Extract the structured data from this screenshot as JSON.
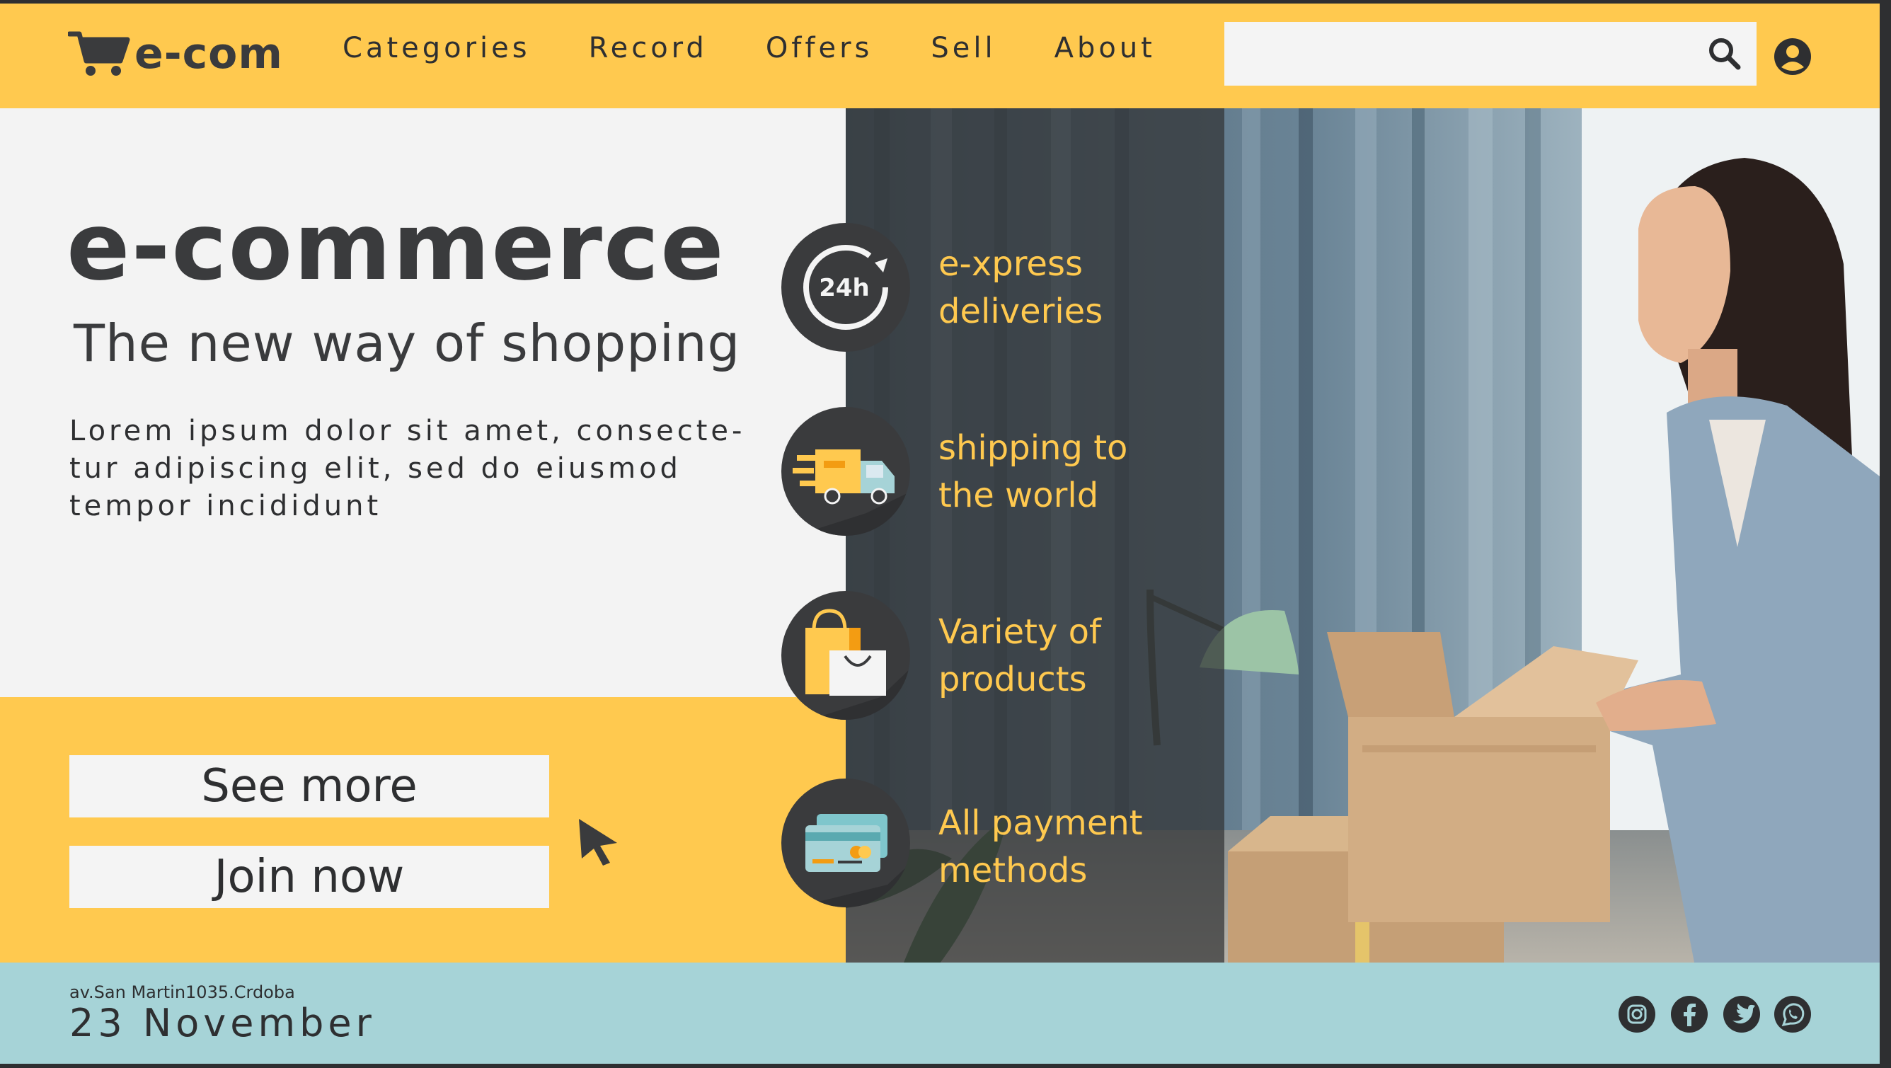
{
  "brand": {
    "name": "e-com",
    "icon": "shopping-cart-icon"
  },
  "nav": {
    "items": [
      {
        "label": "Categories"
      },
      {
        "label": "Record"
      },
      {
        "label": "Offers"
      },
      {
        "label": "Sell"
      },
      {
        "label": "About"
      }
    ]
  },
  "search": {
    "value": "",
    "placeholder": "",
    "icon": "search-icon"
  },
  "account": {
    "icon": "user-account-icon"
  },
  "hero": {
    "title": "e-commerce",
    "subtitle": "The new way of shopping",
    "body_lines": [
      "Lorem ipsum dolor sit amet, consecte-",
      "tur adipiscing elit, sed do eiusmod",
      "tempor incididunt"
    ]
  },
  "buttons": {
    "see_more": "See more",
    "join_now": "Join now"
  },
  "features": [
    {
      "icon": "24h-clock-icon",
      "line1": "e-xpress",
      "line2": "deliveries"
    },
    {
      "icon": "delivery-truck-icon",
      "line1": "shipping to",
      "line2": "the world"
    },
    {
      "icon": "shopping-bags-icon",
      "line1": "Variety of",
      "line2": "products"
    },
    {
      "icon": "credit-cards-icon",
      "line1": "All payment",
      "line2": "methods"
    }
  ],
  "icon_text": {
    "clock": "24h"
  },
  "footer": {
    "address": "av.San Martin1035.Crdoba",
    "date": "23 November",
    "social": [
      "instagram-icon",
      "facebook-icon",
      "twitter-icon",
      "whatsapp-icon"
    ]
  },
  "colors": {
    "accent_yellow": "#ffc94f",
    "dark_gray": "#3a3b3d",
    "light_bg": "#f3f3f3",
    "footer_teal": "#a6d3d7"
  }
}
